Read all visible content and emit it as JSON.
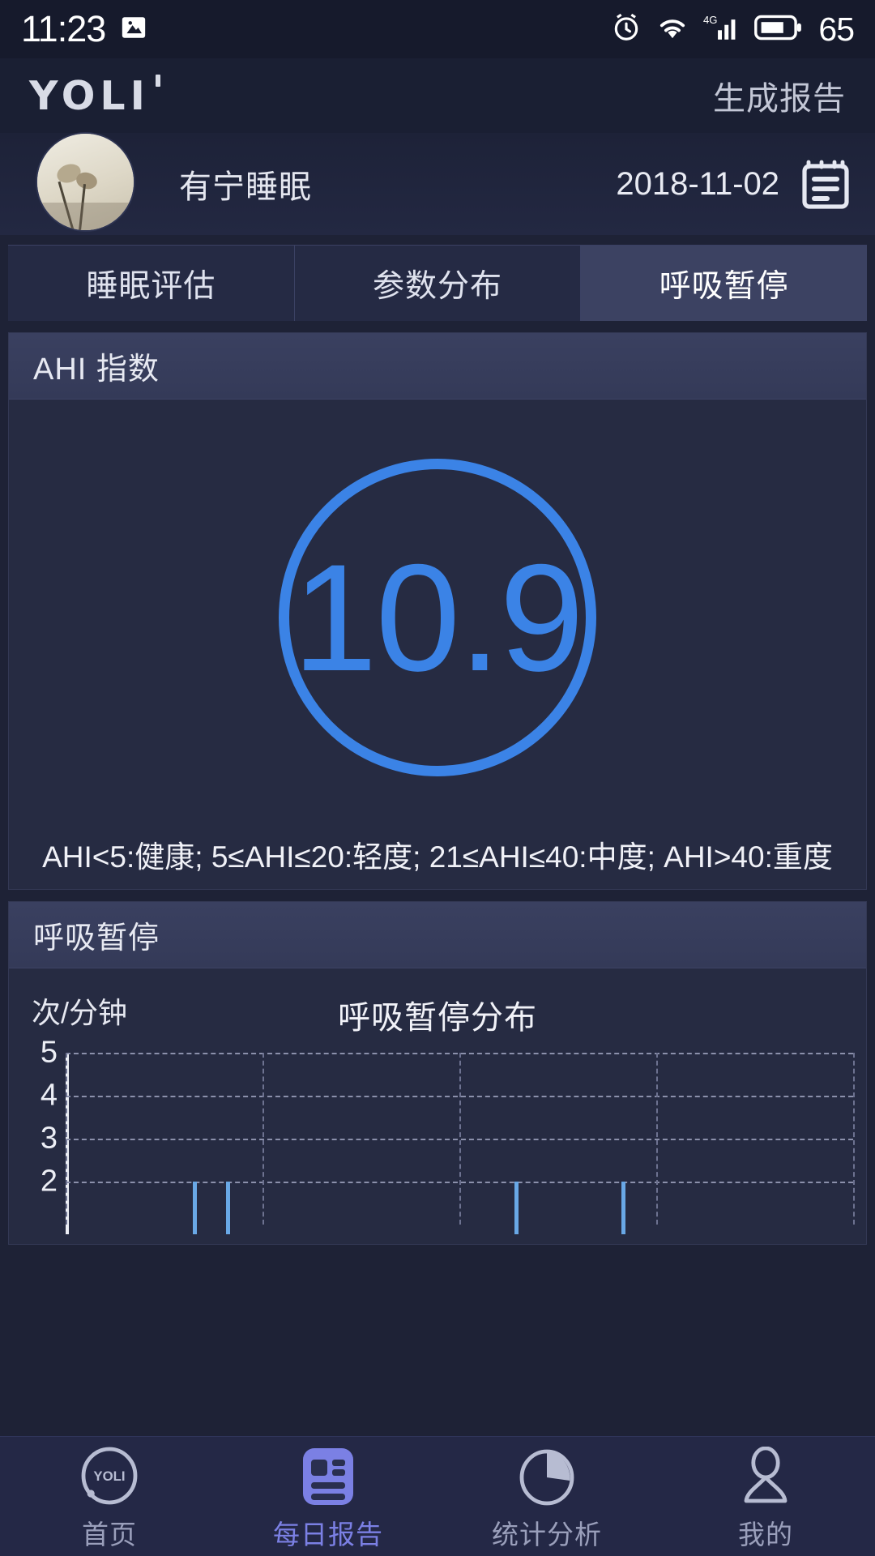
{
  "status_bar": {
    "time": "11:23",
    "battery_percent": "65",
    "network": "4G",
    "icons": [
      "image-icon",
      "alarm-clock-icon",
      "wifi-icon",
      "signal-icon",
      "battery-icon"
    ]
  },
  "header": {
    "brand": "YOLI",
    "action_label": "生成报告"
  },
  "profile": {
    "name": "有宁睡眠",
    "date": "2018-11-02",
    "calendar_icon": "calendar-icon"
  },
  "tabs": [
    {
      "label": "睡眠评估",
      "active": false
    },
    {
      "label": "参数分布",
      "active": false
    },
    {
      "label": "呼吸暂停",
      "active": true
    }
  ],
  "ahi_card": {
    "title": "AHI 指数",
    "value": "10.9",
    "legend": "AHI<5:健康; 5≤AHI≤20:轻度; 21≤AHI≤40:中度; AHI>40:重度",
    "accent_color": "#3b83e6"
  },
  "apnea_card": {
    "title": "呼吸暂停"
  },
  "chart_data": {
    "type": "bar",
    "title": "呼吸暂停分布",
    "ylabel": "次/分钟",
    "xlabel": "",
    "yticks": [
      "5",
      "4",
      "3",
      "2"
    ],
    "ylim": [
      1,
      5
    ],
    "grid": true,
    "legend": "none",
    "bar_color": "#69a8e6",
    "x": [
      16.2,
      20.4,
      57.0,
      70.6
    ],
    "values": [
      2,
      2,
      2,
      2
    ],
    "note": "x values are percent positions across the plot width; bars reach the value 2 gridline"
  },
  "bottom_nav": [
    {
      "label": "首页",
      "icon": "yoli-logo-icon",
      "active": false
    },
    {
      "label": "每日报告",
      "icon": "report-icon",
      "active": true
    },
    {
      "label": "统计分析",
      "icon": "pie-chart-icon",
      "active": false
    },
    {
      "label": "我的",
      "icon": "person-icon",
      "active": false
    }
  ],
  "colors": {
    "background": "#1e2236",
    "card": "#262b42",
    "accent_blue": "#3b83e6",
    "nav_active": "#7b80e4"
  }
}
